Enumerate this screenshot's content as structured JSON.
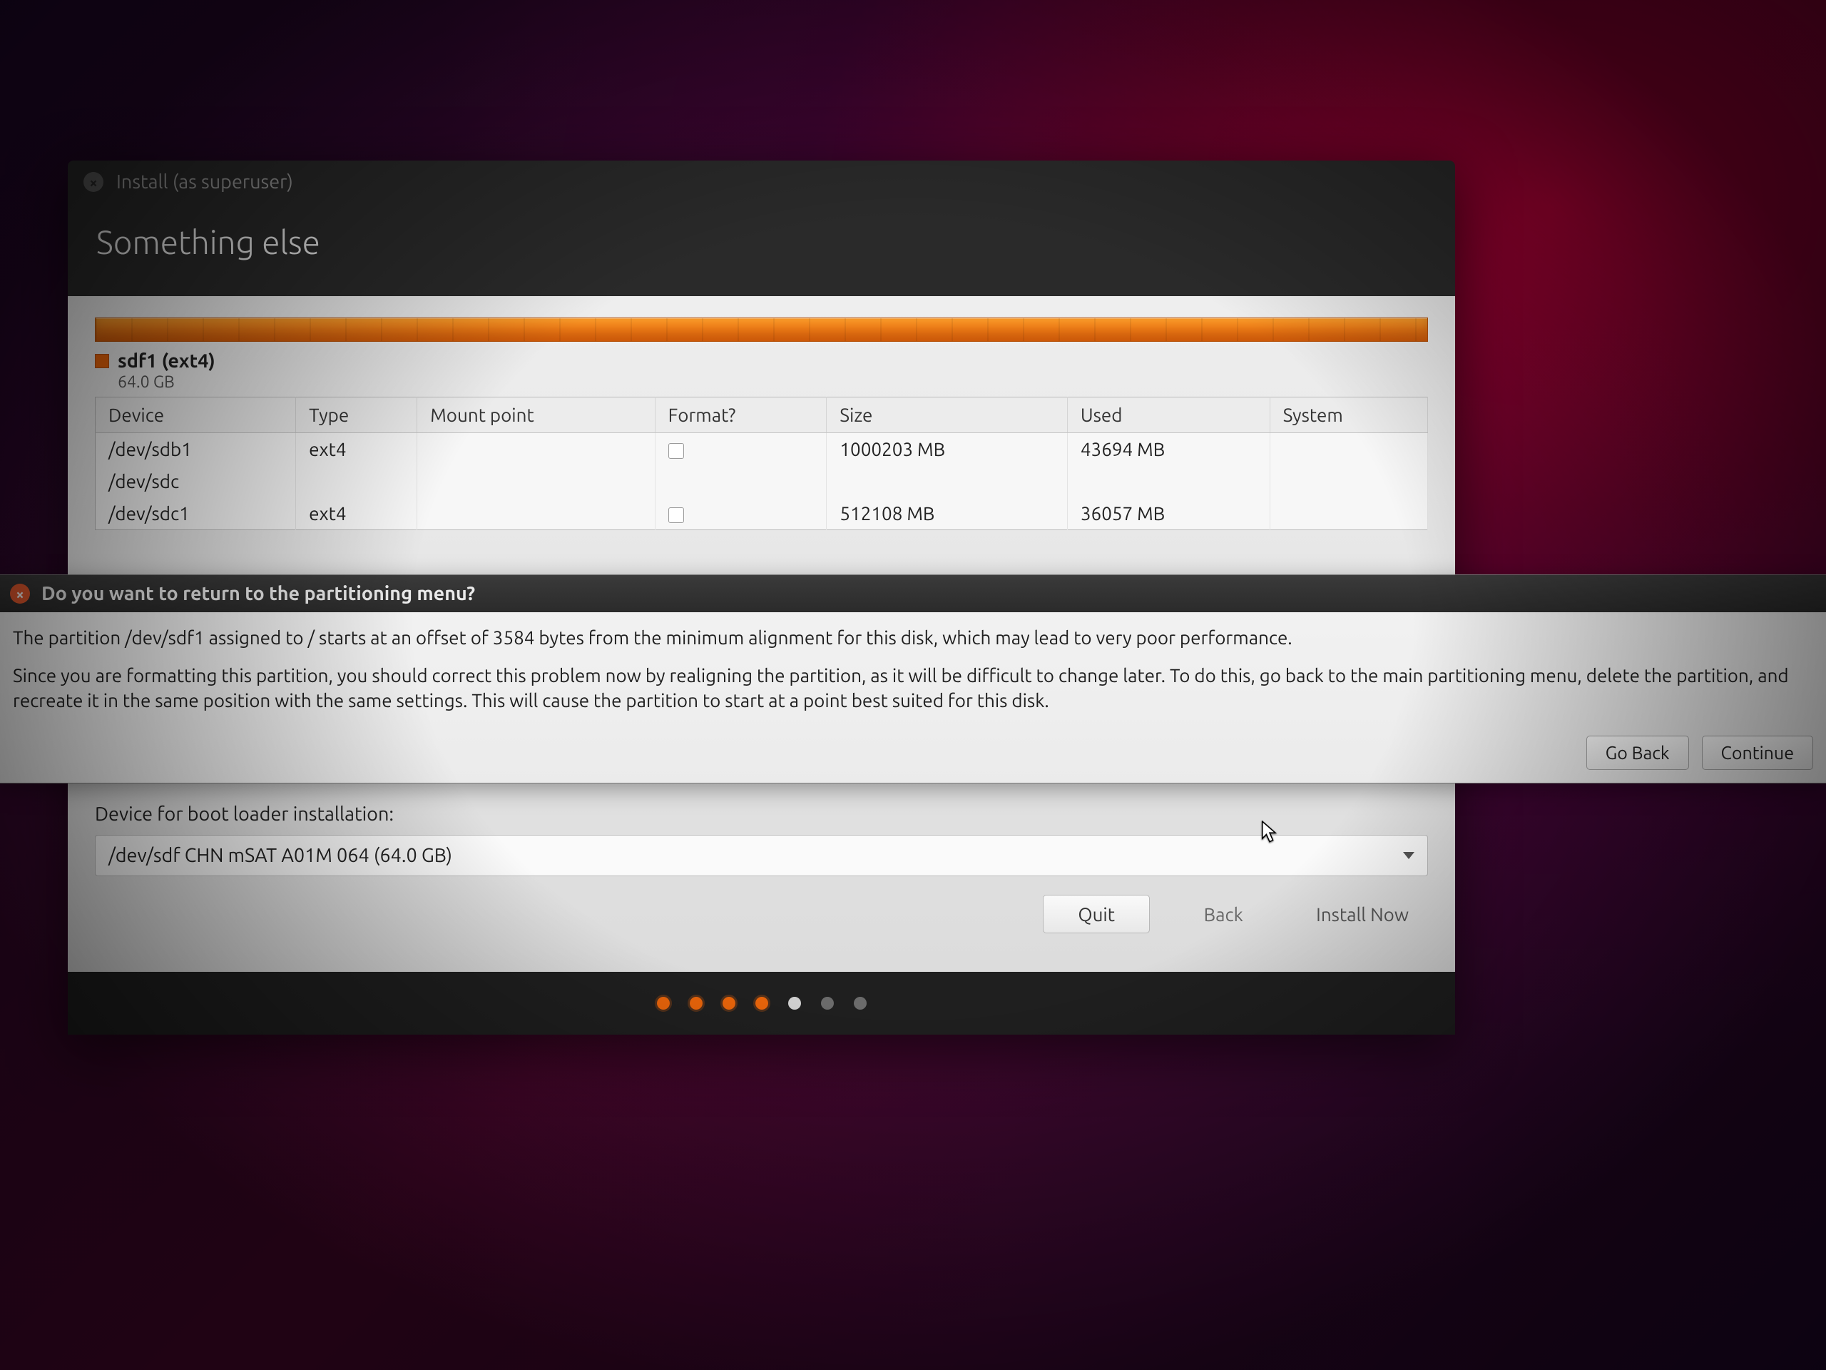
{
  "window": {
    "title": "Install (as superuser)",
    "page_heading": "Something else"
  },
  "disk": {
    "selected_label": "sdf1 (ext4)",
    "selected_size": "64.0 GB"
  },
  "columns": {
    "device": "Device",
    "type": "Type",
    "mount": "Mount point",
    "format": "Format?",
    "size": "Size",
    "used": "Used",
    "system": "System"
  },
  "rows": [
    {
      "device": "/dev/sdb1",
      "type": "ext4",
      "mount": "",
      "format": false,
      "size": "1000203 MB",
      "used": "43694 MB",
      "system": ""
    },
    {
      "device": "/dev/sdc",
      "type": "",
      "mount": "",
      "format": null,
      "size": "",
      "used": "",
      "system": ""
    },
    {
      "device": "/dev/sdc1",
      "type": "ext4",
      "mount": "",
      "format": false,
      "size": "512108 MB",
      "used": "36057 MB",
      "system": ""
    }
  ],
  "boot": {
    "label": "Device for boot loader installation:",
    "value": "/dev/sdf    CHN mSAT A01M 064 (64.0 GB)"
  },
  "buttons": {
    "quit": "Quit",
    "back": "Back",
    "install": "Install Now"
  },
  "dialog": {
    "title": "Do you want to return to the partitioning menu?",
    "p1": "The partition /dev/sdf1 assigned to / starts at an offset of 3584 bytes from the minimum alignment for this disk, which may lead to very poor performance.",
    "p2": "Since you are formatting this partition, you should correct this problem now by realigning the partition, as it will be difficult to change later. To do this, go back to the main partitioning menu, delete the partition, and recreate it in the same position with the same settings. This will cause the partition to start at a point best suited for this disk.",
    "go_back": "Go Back",
    "continue": "Continue"
  },
  "progress_dots": {
    "total": 7,
    "active_index": 2
  }
}
